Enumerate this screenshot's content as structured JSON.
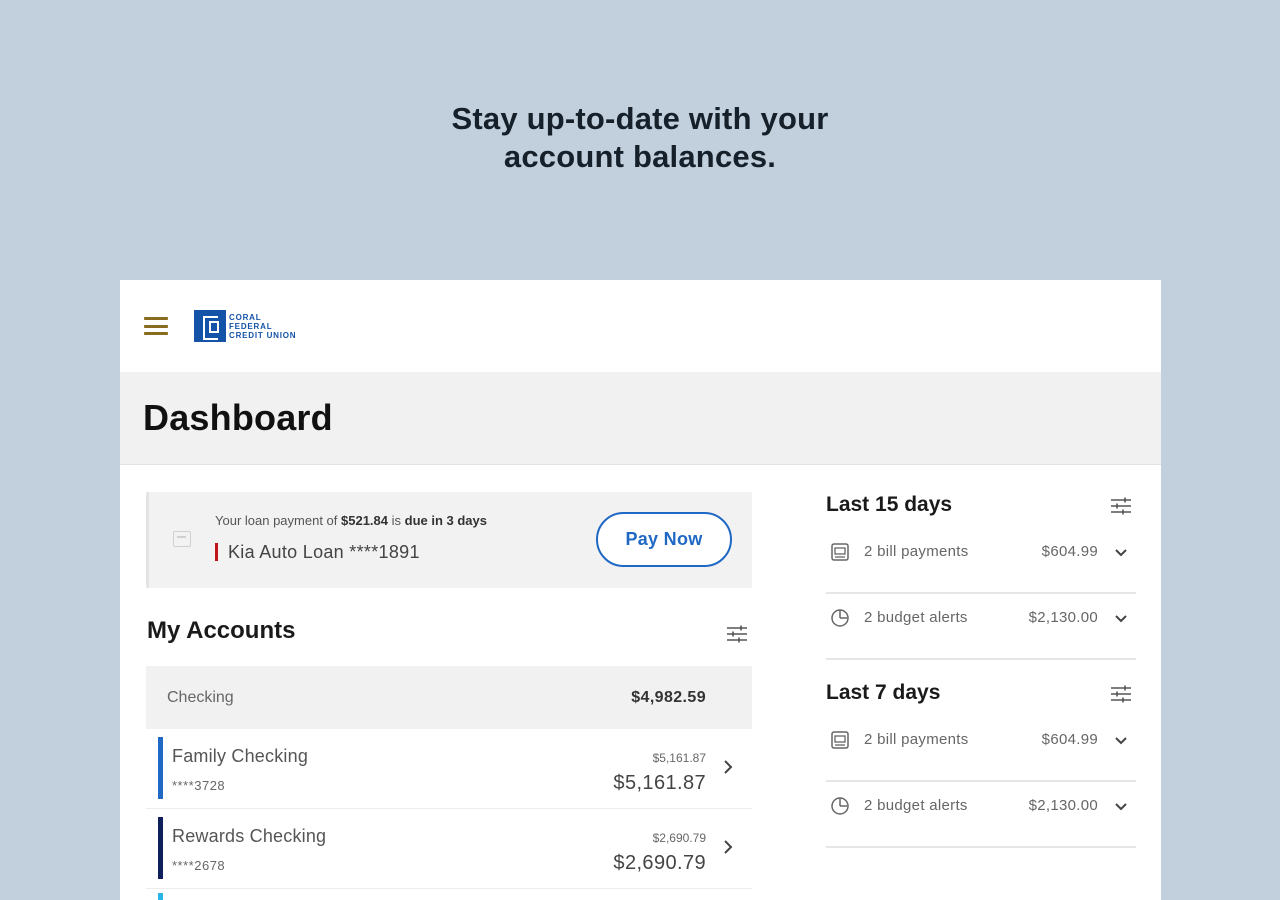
{
  "headline": {
    "line1": "Stay up-to-date with your",
    "line2": "account balances."
  },
  "header": {
    "logo_lines": [
      "Coral",
      "Federal",
      "Credit Union"
    ]
  },
  "page": {
    "title": "Dashboard"
  },
  "loan_banner": {
    "prefix": "Your loan payment of ",
    "amount": "$521.84",
    "mid": " is ",
    "due": "due in 3 days",
    "account": "Kia Auto Loan ****1891",
    "button": "Pay Now",
    "accent_color": "#c0141a"
  },
  "accounts": {
    "title": "My Accounts",
    "group": {
      "label": "Checking",
      "total": "$4,982.59"
    },
    "items": [
      {
        "name": "Family Checking",
        "number": "****3728",
        "available": "$5,161.87",
        "balance": "$5,161.87",
        "color": "#1f68c4"
      },
      {
        "name": "Rewards Checking",
        "number": "****2678",
        "available": "$2,690.79",
        "balance": "$2,690.79",
        "color": "#0f1f5c"
      }
    ]
  },
  "activity": [
    {
      "title": "Last 15 days",
      "items": [
        {
          "icon": "bill-icon",
          "label": "2 bill payments",
          "amount": "$604.99"
        },
        {
          "icon": "budget-icon",
          "label": "2 budget alerts",
          "amount": "$2,130.00"
        }
      ]
    },
    {
      "title": "Last 7 days",
      "items": [
        {
          "icon": "bill-icon",
          "label": "2 bill payments",
          "amount": "$604.99"
        },
        {
          "icon": "budget-icon",
          "label": "2 budget alerts",
          "amount": "$2,130.00"
        }
      ]
    }
  ],
  "colors": {
    "background": "#c1d0dc",
    "brand_blue": "#1553a8",
    "button_blue": "#1f68c4",
    "menu_gold": "#8a6a1c"
  }
}
